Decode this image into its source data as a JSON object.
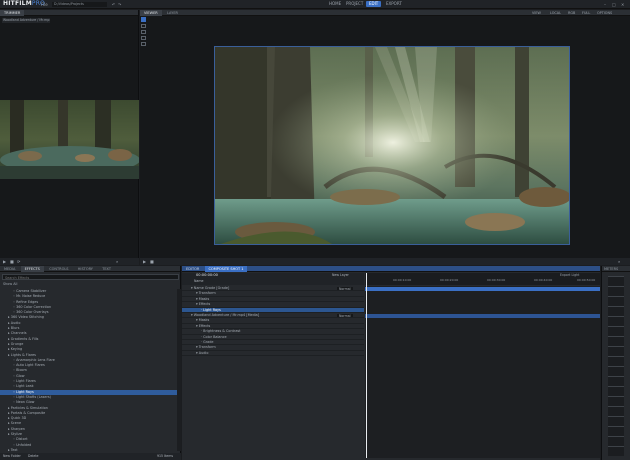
{
  "app": {
    "logo_main": "HITFILM",
    "logo_pro": "PRO",
    "file_menu": "File",
    "project_path": "D:/Videos/Projects",
    "nav": [
      {
        "label": "HOME",
        "active": false
      },
      {
        "label": "PROJECT",
        "active": false
      },
      {
        "label": "EDIT",
        "active": true
      },
      {
        "label": "EXPORT",
        "active": false
      }
    ]
  },
  "left_viewer": {
    "tab": "TRIMMER",
    "source": "Woodland Adventure / Mr.mp4"
  },
  "viewer": {
    "tabs": [
      "VIEWER",
      "LAYER"
    ],
    "controls": [
      "VIEW",
      "LOCAL",
      "RGB",
      "FULL",
      "OPTIONS"
    ]
  },
  "effects": {
    "tabs": [
      "MEDIA",
      "EFFECTS",
      "CONTROLS",
      "HISTORY",
      "TEXT"
    ],
    "search_placeholder": "Search Effects",
    "show_all": "Show All",
    "items": [
      {
        "label": "Camera Stabilizer",
        "indent": 2,
        "sel": false
      },
      {
        "label": "Mr. Noise Reduce",
        "indent": 2,
        "sel": false
      },
      {
        "label": "Refine Edges",
        "indent": 2,
        "sel": false
      },
      {
        "label": "360 Color Correction",
        "indent": 2,
        "sel": false
      },
      {
        "label": "360 Color Overlays",
        "indent": 2,
        "sel": false
      },
      {
        "label": "360 Video Stitching",
        "indent": 1,
        "sel": false
      },
      {
        "label": "Audio",
        "indent": 1,
        "sel": false
      },
      {
        "label": "Blurs",
        "indent": 1,
        "sel": false
      },
      {
        "label": "Channels",
        "indent": 1,
        "sel": false
      },
      {
        "label": "Gradients & Fills",
        "indent": 1,
        "sel": false
      },
      {
        "label": "Grunge",
        "indent": 1,
        "sel": false
      },
      {
        "label": "Keying",
        "indent": 1,
        "sel": false
      },
      {
        "label": "Lights & Flares",
        "indent": 1,
        "sel": false
      },
      {
        "label": "Anamorphic Lens Flare",
        "indent": 2,
        "sel": false
      },
      {
        "label": "Auto Light Flares",
        "indent": 2,
        "sel": false
      },
      {
        "label": "Bloom",
        "indent": 2,
        "sel": false
      },
      {
        "label": "Glow",
        "indent": 2,
        "sel": false
      },
      {
        "label": "Light Flares",
        "indent": 2,
        "sel": false
      },
      {
        "label": "Light Leak",
        "indent": 2,
        "sel": false
      },
      {
        "label": "Light Rays",
        "indent": 2,
        "sel": true
      },
      {
        "label": "Light Shafts (Lasers)",
        "indent": 2,
        "sel": false
      },
      {
        "label": "Neon Glow",
        "indent": 2,
        "sel": false
      },
      {
        "label": "Particles & Simulation",
        "indent": 1,
        "sel": false
      },
      {
        "label": "Portals & Composite",
        "indent": 1,
        "sel": false
      },
      {
        "label": "Quick 3D",
        "indent": 1,
        "sel": false
      },
      {
        "label": "Scene",
        "indent": 1,
        "sel": false
      },
      {
        "label": "Sharpen",
        "indent": 1,
        "sel": false
      },
      {
        "label": "Stylize",
        "indent": 1,
        "sel": false
      },
      {
        "label": "Distort",
        "indent": 2,
        "sel": false
      },
      {
        "label": "Unfolded",
        "indent": 2,
        "sel": false
      },
      {
        "label": "Text",
        "indent": 1,
        "sel": false
      }
    ],
    "footer_left": "New Folder",
    "footer_mid": "Delete",
    "footer_right": "915 Items"
  },
  "timeline": {
    "tabs": [
      "EDITOR",
      "COMPOSITE SHOT 1"
    ],
    "timecode": "00:00:00:00",
    "new_layer": "New Layer",
    "export": "Export Light",
    "column": "Name",
    "ruler": [
      "00:00:10:00",
      "00:00:20:00",
      "00:00:30:00",
      "00:00:40:00",
      "00:00:50:00"
    ],
    "rows": [
      {
        "label": "Name Grade [Grade]",
        "indent": 1,
        "sel": false,
        "mode": "Normal"
      },
      {
        "label": "Transform",
        "indent": 2,
        "sel": false,
        "mode": ""
      },
      {
        "label": "Masks",
        "indent": 2,
        "sel": false,
        "mode": ""
      },
      {
        "label": "Effects",
        "indent": 2,
        "sel": false,
        "mode": ""
      },
      {
        "label": "Light Rays",
        "indent": 3,
        "sel": true,
        "mode": ""
      },
      {
        "label": "Woodland Adventure / Mr.mp4 [Media]",
        "indent": 1,
        "sel": false,
        "mode": "Normal"
      },
      {
        "label": "Masks",
        "indent": 2,
        "sel": false,
        "mode": ""
      },
      {
        "label": "Effects",
        "indent": 2,
        "sel": false,
        "mode": ""
      },
      {
        "label": "Brightness & Contrast",
        "indent": 3,
        "sel": false,
        "mode": ""
      },
      {
        "label": "Color Balance",
        "indent": 3,
        "sel": false,
        "mode": ""
      },
      {
        "label": "Grade",
        "indent": 3,
        "sel": false,
        "mode": ""
      },
      {
        "label": "Transform",
        "indent": 2,
        "sel": false,
        "mode": ""
      },
      {
        "label": "Audio",
        "indent": 2,
        "sel": false,
        "mode": ""
      }
    ]
  },
  "meters": {
    "title": "METERS"
  }
}
